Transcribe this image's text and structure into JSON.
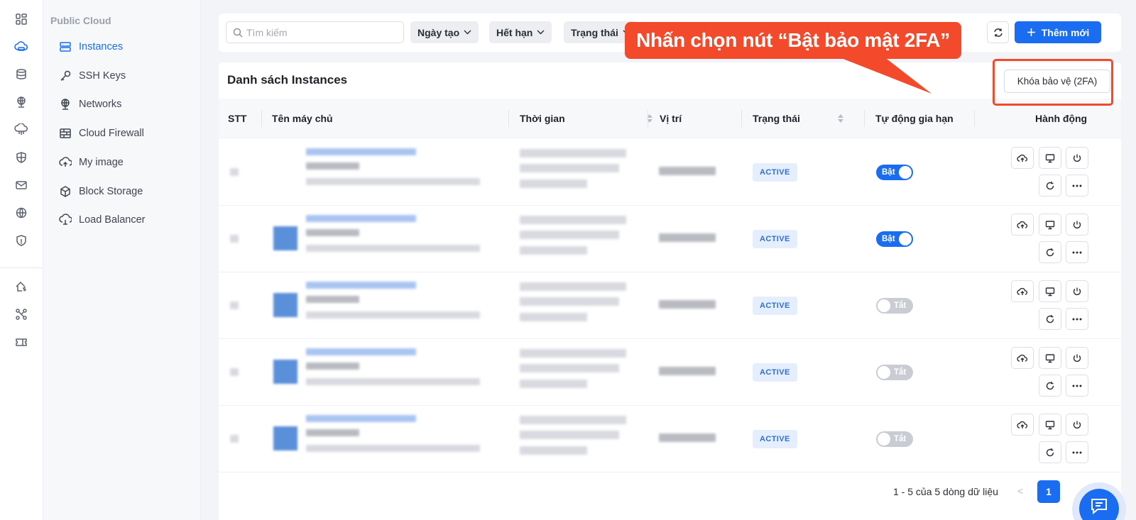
{
  "sidebar": {
    "section_title": "Public Cloud",
    "items": [
      {
        "label": "Instances"
      },
      {
        "label": "SSH Keys"
      },
      {
        "label": "Networks"
      },
      {
        "label": "Cloud Firewall"
      },
      {
        "label": "My image"
      },
      {
        "label": "Block Storage"
      },
      {
        "label": "Load Balancer"
      }
    ]
  },
  "toolbar": {
    "search_placeholder": "Tìm kiếm",
    "filters": [
      "Ngày tạo",
      "Hết hạn",
      "Trạng thái"
    ],
    "add_button": "Thêm mới"
  },
  "panel": {
    "title": "Danh sách Instances",
    "tfa_button": "Khóa bảo vệ (2FA)"
  },
  "table": {
    "headers": [
      "STT",
      "Tên máy chủ",
      "Thời gian",
      "Vị trí",
      "Trạng thái",
      "Tự động gia hạn",
      "Hành động"
    ],
    "rows": [
      {
        "status": "ACTIVE",
        "auto_renew": "Bật"
      },
      {
        "status": "ACTIVE",
        "auto_renew": "Bật"
      },
      {
        "status": "ACTIVE",
        "auto_renew": "Tắt"
      },
      {
        "status": "ACTIVE",
        "auto_renew": "Tắt"
      },
      {
        "status": "ACTIVE",
        "auto_renew": "Tắt"
      }
    ]
  },
  "pagination": {
    "summary": "1 - 5 của 5 dòng dữ liệu",
    "prev": "<",
    "current_page": "1"
  },
  "annotation": {
    "callout_text": "Nhấn chọn nút “Bật bảo mật 2FA”"
  },
  "colors": {
    "primary": "#1a6df0",
    "callout": "#f24a2a",
    "badge_bg": "#e4eefd"
  }
}
